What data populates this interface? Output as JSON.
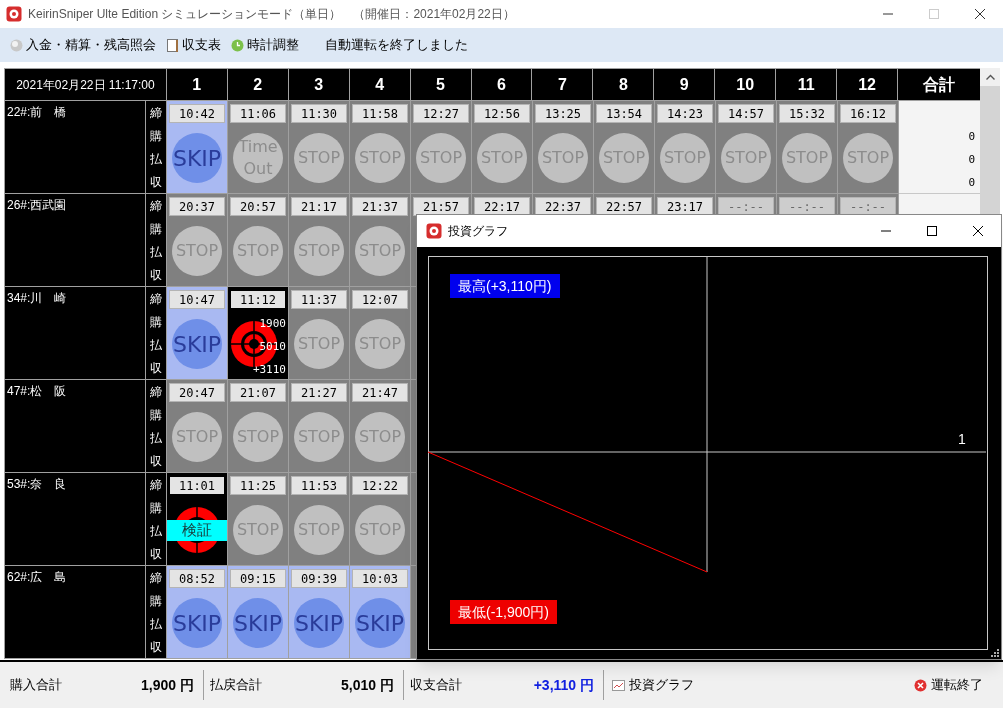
{
  "window": {
    "title": "KeirinSniper Ulte Edition シミュレーションモード（単日）　（開催日：2021年02月22日）"
  },
  "toolbar": {
    "buttons": [
      "入金・精算・残高照会",
      "収支表",
      "時計調整"
    ],
    "message": "自動運転を終了しました"
  },
  "grid": {
    "datetime": "2021年02月22日 11:17:00",
    "columns": [
      "1",
      "2",
      "3",
      "4",
      "5",
      "6",
      "7",
      "8",
      "9",
      "10",
      "11",
      "12"
    ],
    "total_header": "合計",
    "venues": [
      {
        "name": "22#:前　橋",
        "row_labels": [
          "締",
          "購",
          "払",
          "収"
        ],
        "totals": [
          "0",
          "0",
          "0"
        ],
        "cells": [
          {
            "time": "10:42",
            "highlighted": false,
            "disabled": false,
            "status": {
              "kind": "skip",
              "text": "SKIP"
            }
          },
          {
            "time": "11:06",
            "highlighted": false,
            "disabled": false,
            "status": {
              "kind": "timeout",
              "text": "Time Out"
            }
          },
          {
            "time": "11:30",
            "highlighted": false,
            "disabled": false,
            "status": {
              "kind": "stop",
              "text": "STOP"
            }
          },
          {
            "time": "11:58",
            "highlighted": false,
            "disabled": false,
            "status": {
              "kind": "stop",
              "text": "STOP"
            }
          },
          {
            "time": "12:27",
            "highlighted": false,
            "disabled": false,
            "status": {
              "kind": "stop",
              "text": "STOP"
            }
          },
          {
            "time": "12:56",
            "highlighted": false,
            "disabled": false,
            "status": {
              "kind": "stop",
              "text": "STOP"
            }
          },
          {
            "time": "13:25",
            "highlighted": false,
            "disabled": false,
            "status": {
              "kind": "stop",
              "text": "STOP"
            }
          },
          {
            "time": "13:54",
            "highlighted": false,
            "disabled": false,
            "status": {
              "kind": "stop",
              "text": "STOP"
            }
          },
          {
            "time": "14:23",
            "highlighted": false,
            "disabled": false,
            "status": {
              "kind": "stop",
              "text": "STOP"
            }
          },
          {
            "time": "14:57",
            "highlighted": false,
            "disabled": false,
            "status": {
              "kind": "stop",
              "text": "STOP"
            }
          },
          {
            "time": "15:32",
            "highlighted": false,
            "disabled": false,
            "status": {
              "kind": "stop",
              "text": "STOP"
            }
          },
          {
            "time": "16:12",
            "highlighted": false,
            "disabled": false,
            "status": {
              "kind": "stop",
              "text": "STOP"
            }
          }
        ]
      },
      {
        "name": "26#:西武園",
        "row_labels": [
          "締",
          "購",
          "払",
          "収"
        ],
        "cells": [
          {
            "time": "20:37",
            "highlighted": false,
            "disabled": false,
            "status": {
              "kind": "stop",
              "text": "STOP"
            }
          },
          {
            "time": "20:57",
            "highlighted": false,
            "disabled": false,
            "status": {
              "kind": "stop",
              "text": "STOP"
            }
          },
          {
            "time": "21:17",
            "highlighted": false,
            "disabled": false,
            "status": {
              "kind": "stop",
              "text": "STOP"
            }
          },
          {
            "time": "21:37",
            "highlighted": false,
            "disabled": false,
            "status": {
              "kind": "stop",
              "text": "STOP"
            }
          },
          {
            "time": "21:57",
            "highlighted": false,
            "disabled": false
          },
          {
            "time": "22:17",
            "highlighted": false,
            "disabled": false
          },
          {
            "time": "22:37",
            "highlighted": false,
            "disabled": false
          },
          {
            "time": "22:57",
            "highlighted": false,
            "disabled": false
          },
          {
            "time": "23:17",
            "highlighted": false,
            "disabled": false
          },
          {
            "time": "--:--",
            "highlighted": false,
            "disabled": true
          },
          {
            "time": "--:--",
            "highlighted": false,
            "disabled": true
          },
          {
            "time": "--:--",
            "highlighted": false,
            "disabled": true
          }
        ]
      },
      {
        "name": "34#:川　崎",
        "row_labels": [
          "締",
          "購",
          "払",
          "収"
        ],
        "cells": [
          {
            "time": "10:47",
            "highlighted": false,
            "disabled": false,
            "status": {
              "kind": "skip",
              "text": "SKIP"
            }
          },
          {
            "time": "11:12",
            "highlighted": true,
            "disabled": false,
            "status": {
              "kind": "hit",
              "lines": [
                "1900",
                "5010",
                "+3110"
              ]
            }
          },
          {
            "time": "11:37",
            "highlighted": false,
            "disabled": false,
            "status": {
              "kind": "stop",
              "text": "STOP"
            }
          },
          {
            "time": "12:07",
            "highlighted": false,
            "disabled": false,
            "status": {
              "kind": "stop",
              "text": "STOP"
            }
          }
        ]
      },
      {
        "name": "47#:松　阪",
        "row_labels": [
          "締",
          "購",
          "払",
          "収"
        ],
        "cells": [
          {
            "time": "20:47",
            "highlighted": false,
            "disabled": false,
            "status": {
              "kind": "stop",
              "text": "STOP"
            }
          },
          {
            "time": "21:07",
            "highlighted": false,
            "disabled": false,
            "status": {
              "kind": "stop",
              "text": "STOP"
            }
          },
          {
            "time": "21:27",
            "highlighted": false,
            "disabled": false,
            "status": {
              "kind": "stop",
              "text": "STOP"
            }
          },
          {
            "time": "21:47",
            "highlighted": false,
            "disabled": false,
            "status": {
              "kind": "stop",
              "text": "STOP"
            }
          }
        ]
      },
      {
        "name": "53#:奈　良",
        "row_labels": [
          "締",
          "購",
          "払",
          "収"
        ],
        "cells": [
          {
            "time": "11:01",
            "highlighted": true,
            "disabled": false,
            "status": {
              "kind": "verify",
              "text": "検証"
            }
          },
          {
            "time": "11:25",
            "highlighted": false,
            "disabled": false,
            "status": {
              "kind": "stop",
              "text": "STOP"
            }
          },
          {
            "time": "11:53",
            "highlighted": false,
            "disabled": false,
            "status": {
              "kind": "stop",
              "text": "STOP"
            }
          },
          {
            "time": "12:22",
            "highlighted": false,
            "disabled": false,
            "status": {
              "kind": "stop",
              "text": "STOP"
            }
          }
        ]
      },
      {
        "name": "62#:広　島",
        "row_labels": [
          "締",
          "購",
          "払",
          "収"
        ],
        "cells": [
          {
            "time": "08:52",
            "highlighted": false,
            "disabled": false,
            "status": {
              "kind": "skip",
              "text": "SKIP"
            }
          },
          {
            "time": "09:15",
            "highlighted": false,
            "disabled": false,
            "status": {
              "kind": "skip",
              "text": "SKIP"
            }
          },
          {
            "time": "09:39",
            "highlighted": false,
            "disabled": false,
            "status": {
              "kind": "skip",
              "text": "SKIP"
            }
          },
          {
            "time": "10:03",
            "highlighted": false,
            "disabled": false,
            "status": {
              "kind": "skip",
              "text": "SKIP"
            }
          }
        ]
      }
    ]
  },
  "graph_window": {
    "title": "投資グラフ",
    "max_label": "最高(+3,110円)",
    "min_label": "最低(-1,900円)",
    "marker": "1"
  },
  "footer": {
    "totals": [
      {
        "label": "購入合計",
        "value": "1,900 円",
        "kind": "plain"
      },
      {
        "label": "払戻合計",
        "value": "5,010 円",
        "kind": "plain"
      },
      {
        "label": "収支合計",
        "value": "+3,110 円",
        "kind": "profit"
      }
    ],
    "graph_button": "投資グラフ",
    "stop_button": "運転終了"
  }
}
